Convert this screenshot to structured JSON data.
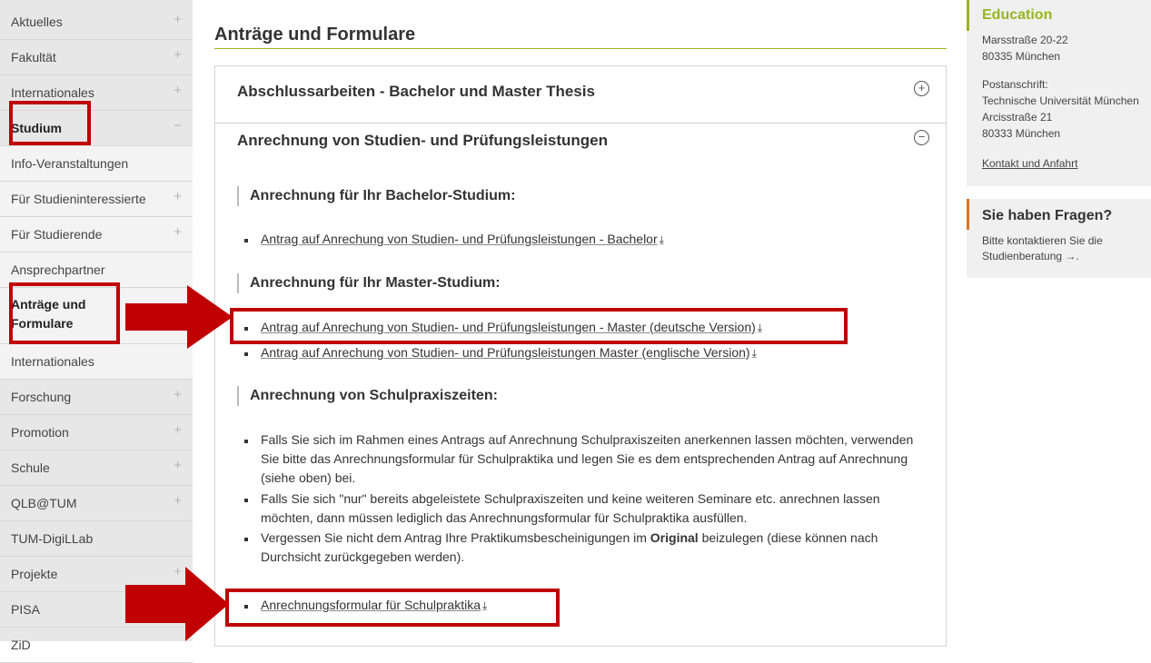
{
  "sidebar": {
    "items": [
      {
        "label": "Aktuelles",
        "pm": "+"
      },
      {
        "label": "Fakultät",
        "pm": "+"
      },
      {
        "label": "Internationales",
        "pm": "+"
      },
      {
        "label": "Studium",
        "pm": "−"
      },
      {
        "label": "Info-Veranstaltungen",
        "pm": ""
      },
      {
        "label": "Für Studieninteressierte",
        "pm": "+"
      },
      {
        "label": "Für Studierende",
        "pm": "+"
      },
      {
        "label": "Ansprechpartner",
        "pm": ""
      },
      {
        "label": "Anträge und Formulare",
        "pm": ""
      },
      {
        "label": "Internationales",
        "pm": ""
      },
      {
        "label": "Forschung",
        "pm": "+"
      },
      {
        "label": "Promotion",
        "pm": "+"
      },
      {
        "label": "Schule",
        "pm": "+"
      },
      {
        "label": "QLB@TUM",
        "pm": "+"
      },
      {
        "label": "TUM-DigiLLab",
        "pm": ""
      },
      {
        "label": "Projekte",
        "pm": "+"
      },
      {
        "label": "PISA",
        "pm": ""
      },
      {
        "label": "ZiD",
        "pm": ""
      }
    ]
  },
  "main": {
    "title": "Anträge und Formulare",
    "accordion": [
      {
        "title": "Abschlussarbeiten - Bachelor und Master Thesis",
        "toggle": "+"
      },
      {
        "title": "Anrechnung von Studien- und Prüfungsleistungen",
        "toggle": "−"
      }
    ],
    "sections": [
      {
        "heading": "Anrechnung für Ihr Bachelor-Studium:",
        "links": [
          "Antrag auf Anrechung von Studien- und Prüfungsleistungen - Bachelor"
        ]
      },
      {
        "heading": "Anrechnung für Ihr Master-Studium:",
        "links": [
          "Antrag auf Anrechung von Studien- und Prüfungsleistungen - Master (deutsche Version)",
          "Antrag auf Anrechung von Studien- und Prüfungsleistungen Master (englische Version)"
        ]
      },
      {
        "heading": "Anrechnung von Schulpraxiszeiten:",
        "paras": [
          "Falls Sie sich im Rahmen eines Antrags auf Anrechnung Schulpraxiszeiten anerkennen lassen möchten, verwenden Sie bitte das Anrechnungsformular für Schulpraktika und legen Sie es dem entsprechenden Antrag auf Anrechnung (siehe oben) bei.",
          "Falls Sie sich \"nur\" bereits abgeleistete Schulpraxiszeiten und keine weiteren Seminare etc. anrechnen lassen möchten, dann müssen lediglich das Anrechnungsformular für Schulpraktika ausfüllen.",
          {
            "before": "Vergessen Sie nicht dem Antrag Ihre Praktikumsbescheinigungen im ",
            "bold": "Original",
            "after": " beizulegen (diese können nach Durchsicht zurückgegeben werden)."
          }
        ],
        "links": [
          "Anrechnungsformular für Schulpraktika"
        ]
      }
    ],
    "download_glyph": "⤓"
  },
  "right": {
    "education": {
      "title": "Education",
      "lines": [
        "Marsstraße 20-22",
        "80335 München"
      ],
      "postanschrift": [
        "Postanschrift:",
        "Technische Universität München",
        "Arcisstraße 21",
        "80333 München"
      ],
      "link": "Kontakt und Anfahrt"
    },
    "fragen": {
      "title": "Sie haben Fragen?",
      "lines": [
        "Bitte kontaktieren Sie die",
        "Studienberatung →."
      ]
    }
  },
  "colors": {
    "accent_green": "#9ab520",
    "accent_orange": "#e37222",
    "annotation_red": "#c00000"
  }
}
